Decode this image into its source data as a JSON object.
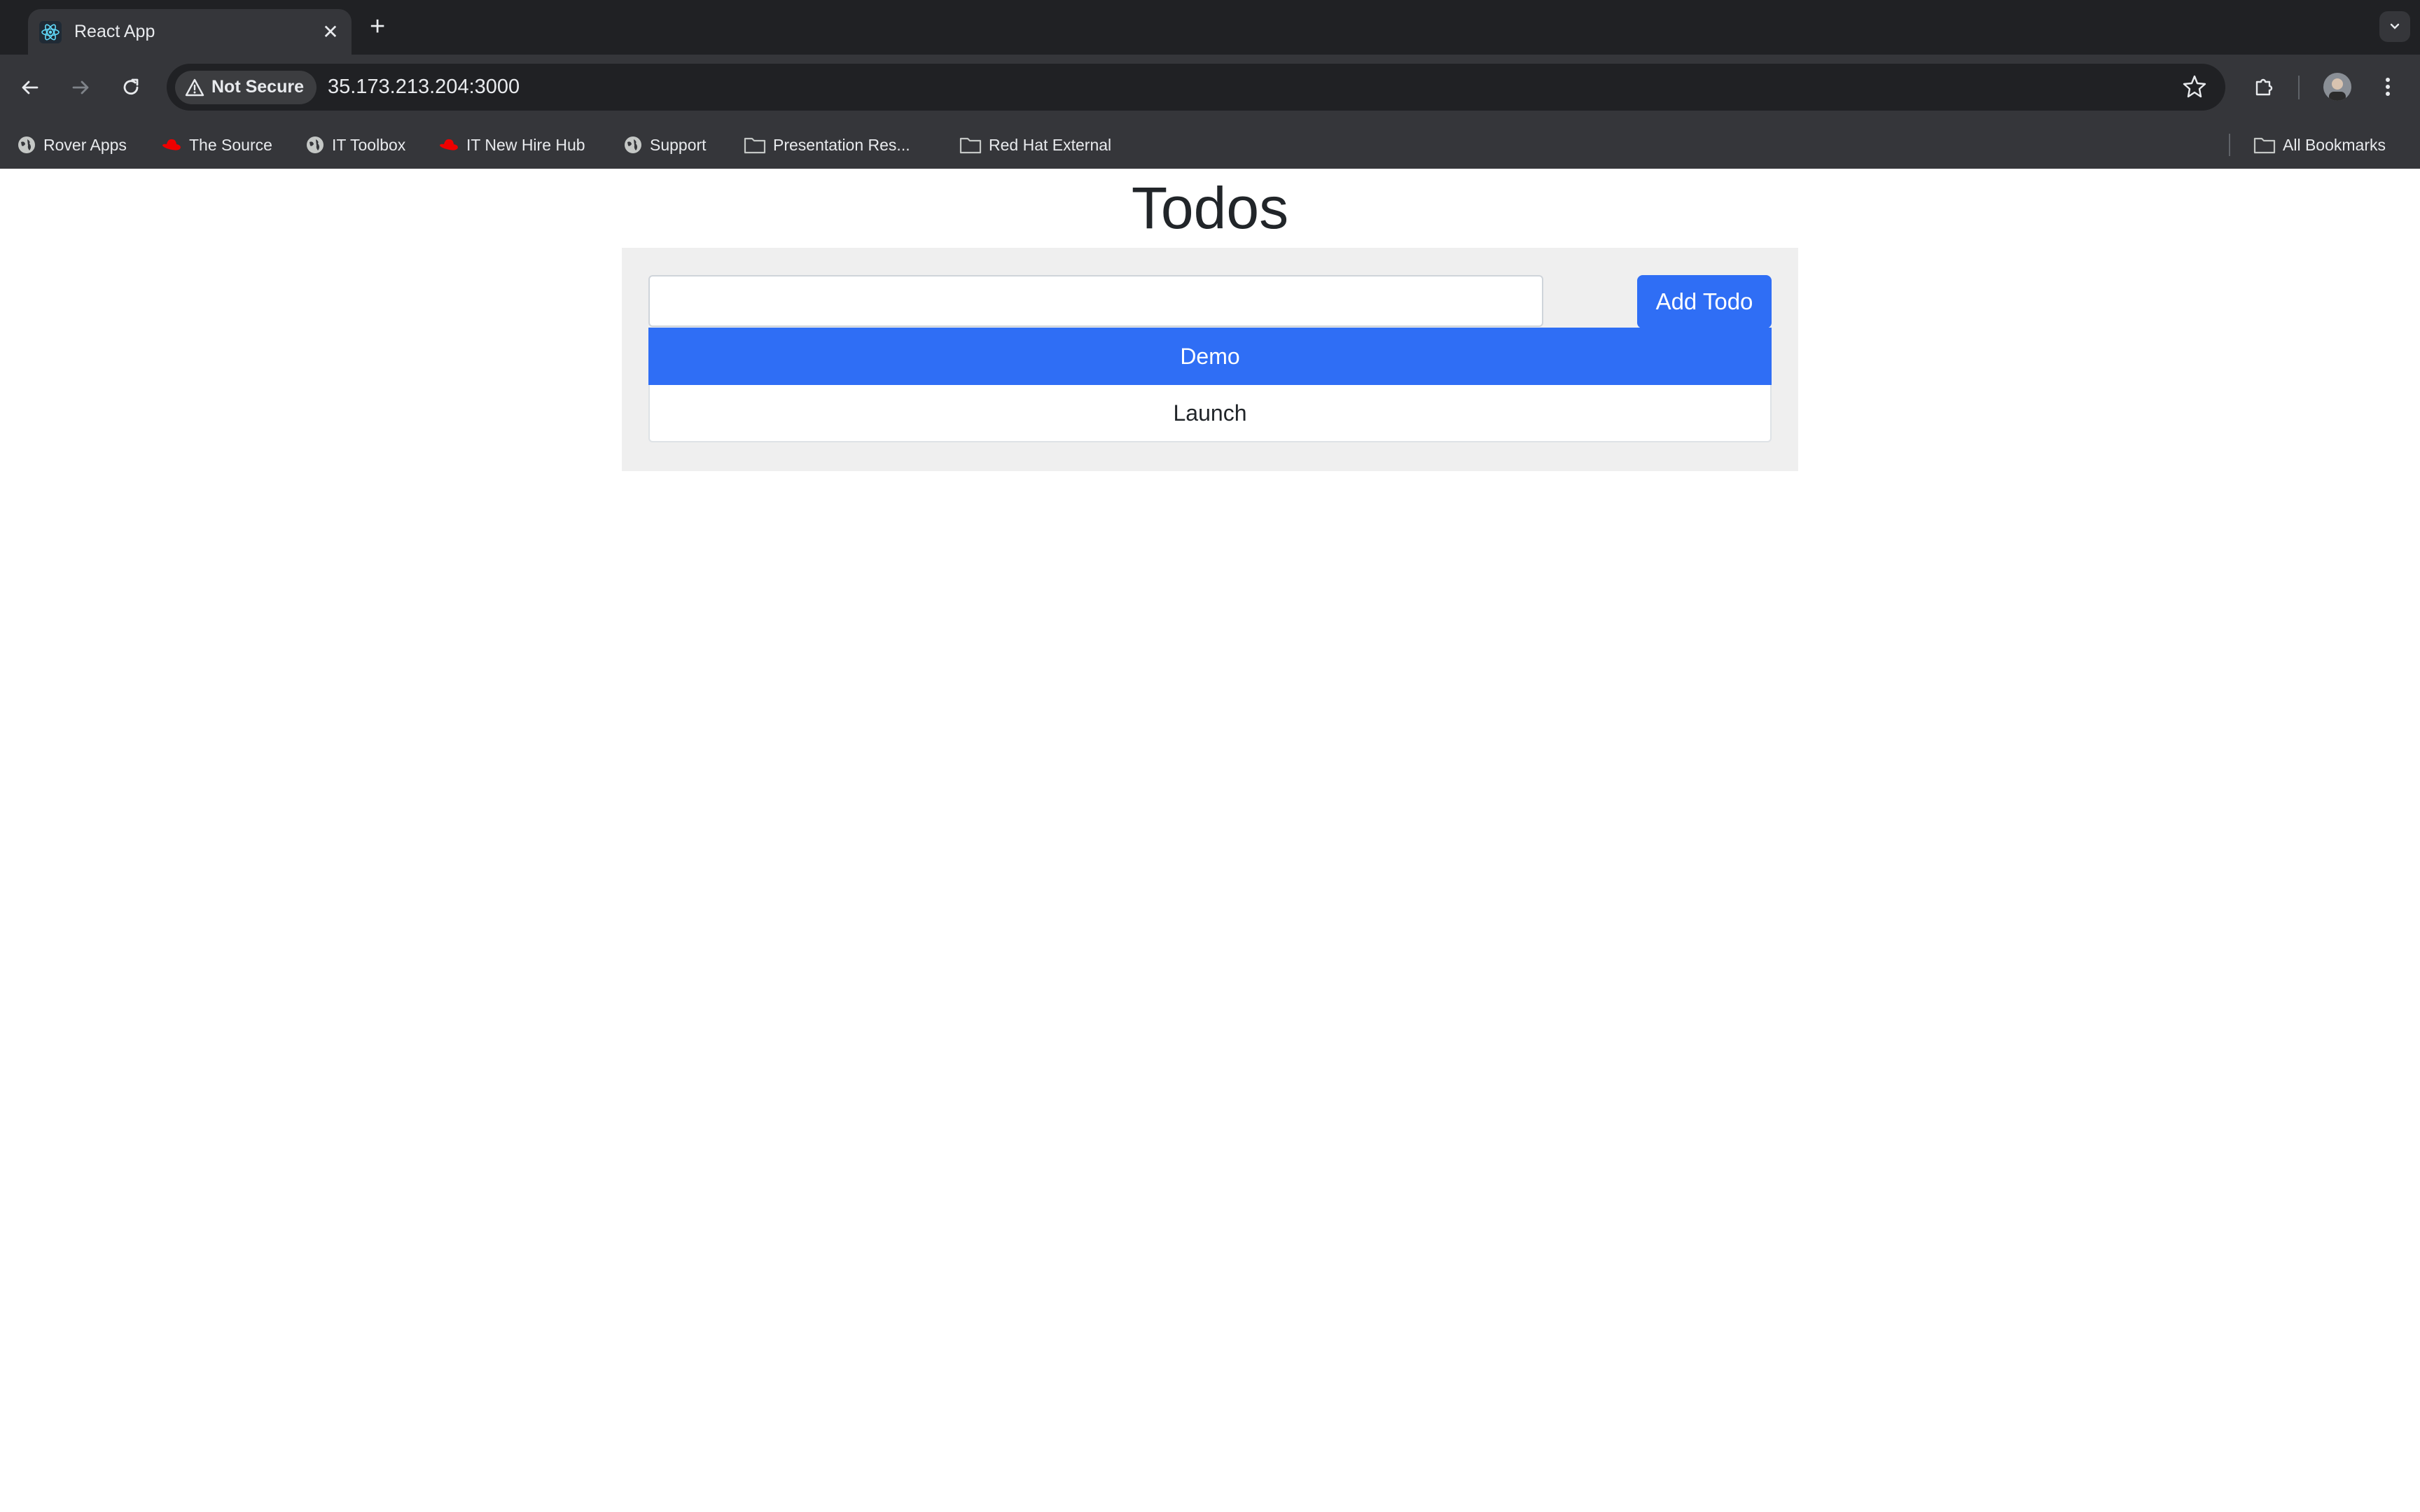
{
  "browser": {
    "tab": {
      "title": "React App",
      "close_glyph": "✕",
      "favicon": "react-icon"
    },
    "new_tab_glyph": "+",
    "omnibox": {
      "security_label": "Not Secure",
      "url": "35.173.213.204:3000"
    },
    "bookmarks": [
      {
        "label": "Rover Apps",
        "icon": "globe-icon"
      },
      {
        "label": "The Source",
        "icon": "redhat-icon"
      },
      {
        "label": "IT Toolbox",
        "icon": "globe-icon"
      },
      {
        "label": "IT New Hire Hub",
        "icon": "redhat-icon"
      },
      {
        "label": "Support",
        "icon": "globe-icon"
      },
      {
        "label": "Presentation Res...",
        "icon": "folder-icon"
      },
      {
        "label": "Red Hat External",
        "icon": "folder-icon"
      }
    ],
    "all_bookmarks_label": "All Bookmarks"
  },
  "app": {
    "title": "Todos",
    "input": {
      "value": "",
      "placeholder": ""
    },
    "add_button_label": "Add Todo",
    "todos": [
      {
        "label": "Demo",
        "selected": true
      },
      {
        "label": "Launch",
        "selected": false
      }
    ]
  },
  "colors": {
    "accent": "#2f6ef5",
    "card_bg": "#efefef",
    "chrome_dark": "#202124",
    "chrome": "#35363a"
  }
}
